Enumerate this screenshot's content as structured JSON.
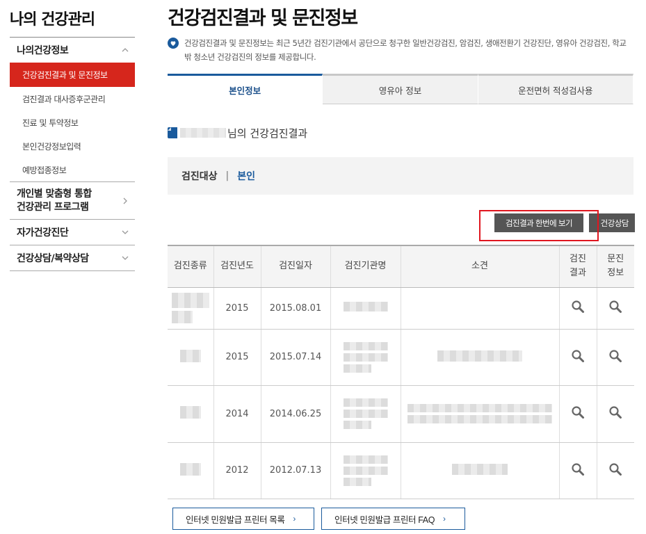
{
  "sidebar": {
    "title": "나의 건강관리",
    "groups": [
      {
        "label": "나의건강정보",
        "expanded": true,
        "items": [
          {
            "label": "건강검진결과 및 문진정보",
            "active": true
          },
          {
            "label": "검진결과 대사증후군관리",
            "active": false
          },
          {
            "label": "진료 및 투약정보",
            "active": false
          },
          {
            "label": "본인건강정보입력",
            "active": false
          },
          {
            "label": "예방접종정보",
            "active": false
          }
        ]
      },
      {
        "label_line1": "개인별 맞춤형 통합",
        "label_line2": "건강관리 프로그램",
        "expanded": false
      },
      {
        "label": "자가건강진단",
        "expanded": false
      },
      {
        "label": "건강상담/복약상담",
        "expanded": false
      }
    ]
  },
  "page": {
    "title": "건강검진결과 및 문진정보",
    "description": "건강검진결과 및 문진정보는 최근 5년간 검진기관에서 공단으로 청구한 일반건강검진, 암검진, 생애전환기 건강진단, 영유아 건강검진, 학교 밖 청소년 건강검진의 정보를 제공합니다."
  },
  "tabs": [
    {
      "label": "본인정보",
      "active": true
    },
    {
      "label": "영유아 정보",
      "active": false
    },
    {
      "label": "운전면허 적성검사용",
      "active": false
    }
  ],
  "section": {
    "title_suffix": "님의 건강검진결과",
    "target_label": "검진대상",
    "target_value": "본인"
  },
  "buttons": {
    "view_all": "검진결과 한번에 보기",
    "consult": "건강상담"
  },
  "table": {
    "headers": [
      "검진종류",
      "검진년도",
      "검진일자",
      "검진기관명",
      "소견",
      "검진\n결과",
      "문진\n정보"
    ],
    "rows": [
      {
        "year": "2015",
        "date": "2015.08.01"
      },
      {
        "year": "2015",
        "date": "2015.07.14"
      },
      {
        "year": "2014",
        "date": "2014.06.25"
      },
      {
        "year": "2012",
        "date": "2012.07.13"
      }
    ]
  },
  "footer_buttons": [
    {
      "label": "인터넷 민원발급 프린터 목록"
    },
    {
      "label": "인터넷 민원발급 프린터 FAQ"
    }
  ],
  "colors": {
    "active_menu": "#d6261c",
    "accent_blue": "#1a5a9c",
    "highlight_red": "#e0161f",
    "dark_button": "#555555"
  },
  "icons": {
    "description": "heart-icon",
    "section_title": "document-icon",
    "row_action": "magnifier-icon",
    "menu_toggle": "chevron-icon"
  }
}
